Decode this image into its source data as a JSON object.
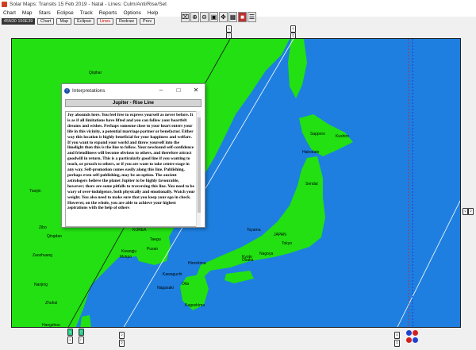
{
  "window": {
    "title": "Solar Maps: Transits 15 Feb 2019 - Natal - Lines: Culm/Anti/Rise/Set"
  },
  "menu": [
    "Chart",
    "Map",
    "Stars",
    "Eclipse",
    "Track",
    "Reports",
    "Options",
    "Help"
  ],
  "toolbar_icons": [
    "compass-icon",
    "zoom-in-icon",
    "zoom-out-icon",
    "zoom-reset-icon",
    "pan-icon",
    "grid-icon",
    "color-icon",
    "legend-icon"
  ],
  "status": {
    "coords": "45N30 150E39",
    "buttons": [
      "Chart",
      "Map",
      "Eclipse",
      "Lines",
      "Redraw",
      "Prev"
    ]
  },
  "map": {
    "place_labels": {
      "qiqihar": "Qiqihar",
      "sapporo": "Sapporo",
      "kushiro": "Kushiro",
      "hakodate": "Hakodate",
      "sendai": "Sendai",
      "tokyo": "Tokyo",
      "nagoya": "Nagoya",
      "kyoto": "Kyoto",
      "osaka": "Osaka",
      "hiroshima": "Hiroshima",
      "kawaguchi": "Kawaguchi",
      "oita": "Oita",
      "nagasaki": "Nagasaki",
      "kagoshima": "Kagoshima",
      "japan": "JAPAN",
      "toyama": "Toyama",
      "korea": "KOREA",
      "taegu": "Taegu",
      "kwangju": "Kwangju",
      "pusan": "Pusan",
      "mokpo": "Mokpo",
      "zibo": "Zibo",
      "qingdao": "Qingdao",
      "zaozhuang": "Zaozhuang",
      "nanjing": "Nanjing",
      "hangzhou": "Hangzhou",
      "tianjin": "Tianjin",
      "zhuhai": "Zhuhai"
    }
  },
  "dialog": {
    "title": "Interpretations",
    "heading": "Jupiter - Rise Line",
    "text": "Joy abounds here. You feel free to express yourself as never before. It is as if all limitations have lifted and you can follow your heartfelt dreams and wishes. Perhaps someone close to your heart enters your life in this vicinity, a potential marriage partner or benefactor. Either way this location is highly beneficial for your happiness and welfare. If you want to expand your world and throw yourself into the limelight then this is the line to follow. Your newfound self-confidence and friendliness will become obvious to others, and therefore attract goodwill in return. This is a particularly good line if you wanting to teach, or preach to others, or if you are want to take centre stage in any way. Self-promotion comes easily along this line. Publishing, perhaps even self-publishing, may be an option. The ancient astrologers believe the planet Jupiter to be highly favourable, however; there are some pitfalls to traversing this line. You need to be wary of over-indulgence, both physically and emotionally. Watch your weight. You also need to make sure that you keep your ego in check. However, on the whole, you are able to achieve your highest aspirations with the help of others"
  },
  "colors": {
    "ocean": "#1e7fe0",
    "land": "#22e012",
    "dialog_icon": "#1a4ea8"
  }
}
